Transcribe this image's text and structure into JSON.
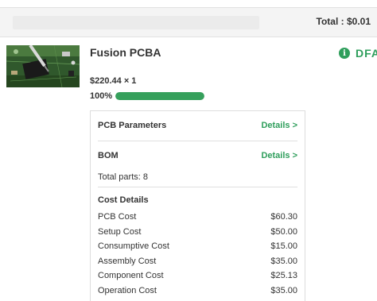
{
  "header": {
    "total_label": "Total : $0.01"
  },
  "product": {
    "title": "Fusion PCBA",
    "price_qty": "$220.44 × 1",
    "progress_text": "100%",
    "progress_value": 1.0,
    "dfa_label": "DFA",
    "info_icon": "info-circle-icon"
  },
  "panel": {
    "pcb_params": {
      "title": "PCB Parameters",
      "link": "Details >"
    },
    "bom": {
      "title": "BOM",
      "link": "Details >"
    },
    "total_parts": "Total parts: 8",
    "cost_details_title": "Cost Details",
    "costs": [
      {
        "label": "PCB Cost",
        "value": "$60.30"
      },
      {
        "label": "Setup Cost",
        "value": "$50.00"
      },
      {
        "label": "Consumptive Cost",
        "value": "$15.00"
      },
      {
        "label": "Assembly Cost",
        "value": "$35.00"
      },
      {
        "label": "Component Cost",
        "value": "$25.13"
      },
      {
        "label": "Operation Cost",
        "value": "$35.00"
      }
    ]
  },
  "colors": {
    "accent": "#2e9e5b",
    "progress": "#36a05c",
    "header_bg": "#f4f4f4"
  }
}
